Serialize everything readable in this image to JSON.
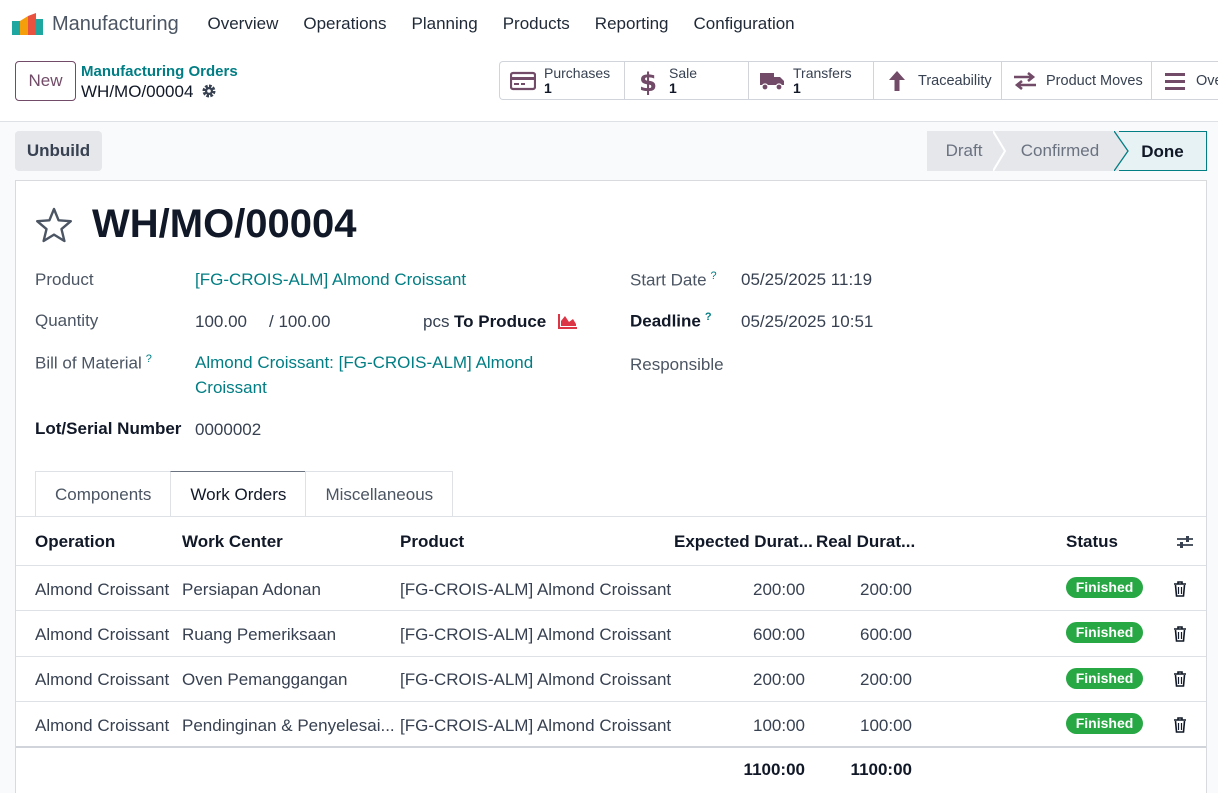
{
  "app": {
    "name": "Manufacturing"
  },
  "menu": [
    "Overview",
    "Operations",
    "Planning",
    "Products",
    "Reporting",
    "Configuration"
  ],
  "control_panel": {
    "new_label": "New",
    "breadcrumb_parent": "Manufacturing Orders",
    "breadcrumb_current": "WH/MO/00004"
  },
  "smart_buttons": {
    "purchases": {
      "label": "Purchases",
      "count": "1"
    },
    "sale": {
      "label": "Sale",
      "count": "1"
    },
    "transfers": {
      "label": "Transfers",
      "count": "1"
    },
    "traceability": {
      "label": "Traceability"
    },
    "product_moves": {
      "label": "Product Moves"
    },
    "overview": {
      "label": "Ove"
    }
  },
  "actions": {
    "unbuild": "Unbuild"
  },
  "status": {
    "stages": [
      "Draft",
      "Confirmed",
      "Done"
    ],
    "current": "Done"
  },
  "record": {
    "title": "WH/MO/00004",
    "fields": {
      "product_label": "Product",
      "product_value": "[FG-CROIS-ALM] Almond Croissant",
      "quantity_label": "Quantity",
      "quantity_value": "100.00",
      "quantity_total": "/ 100.00",
      "quantity_uom": "pcs",
      "to_produce": "To Produce",
      "bom_label": "Bill of Material",
      "bom_value_line1": "Almond Croissant: [FG-CROIS-ALM] Almond",
      "bom_value_line2": "Croissant",
      "lot_label": "Lot/Serial Number",
      "lot_value": "0000002",
      "start_date_label": "Start Date",
      "start_date_value": "05/25/2025 11:19",
      "deadline_label": "Deadline",
      "deadline_value": "05/25/2025 10:51",
      "responsible_label": "Responsible",
      "help_mark": "?"
    }
  },
  "tabs": [
    "Components",
    "Work Orders",
    "Miscellaneous"
  ],
  "work_orders": {
    "columns": [
      "Operation",
      "Work Center",
      "Product",
      "Expected Durat...",
      "Real Durat...",
      "Status"
    ],
    "rows": [
      {
        "operation": "Almond Croissant",
        "work_center": "Persiapan Adonan",
        "product": "[FG-CROIS-ALM] Almond Croissant",
        "expected": "200:00",
        "real": "200:00",
        "status": "Finished"
      },
      {
        "operation": "Almond Croissant",
        "work_center": "Ruang Pemeriksaan",
        "product": "[FG-CROIS-ALM] Almond Croissant",
        "expected": "600:00",
        "real": "600:00",
        "status": "Finished"
      },
      {
        "operation": "Almond Croissant",
        "work_center": "Oven Pemanggangan",
        "product": "[FG-CROIS-ALM] Almond Croissant",
        "expected": "200:00",
        "real": "200:00",
        "status": "Finished"
      },
      {
        "operation": "Almond Croissant",
        "work_center": "Pendinginan & Penyelesai...",
        "product": "[FG-CROIS-ALM] Almond Croissant",
        "expected": "100:00",
        "real": "100:00",
        "status": "Finished"
      }
    ],
    "totals": {
      "expected": "1100:00",
      "real": "1100:00"
    }
  },
  "colors": {
    "primary": "#714b67",
    "link": "#017e84",
    "success": "#28a745"
  }
}
